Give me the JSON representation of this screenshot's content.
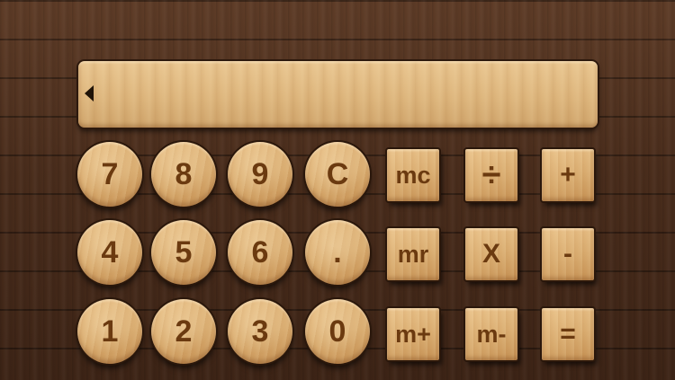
{
  "display": {
    "value": "",
    "speaker_icon": "speaker-icon"
  },
  "keys": {
    "k7": "7",
    "k8": "8",
    "k9": "9",
    "clear": "C",
    "k4": "4",
    "k5": "5",
    "k6": "6",
    "dot": ".",
    "k1": "1",
    "k2": "2",
    "k3": "3",
    "k0": "0",
    "mc": "mc",
    "mr": "mr",
    "mplus": "m+",
    "mminus": "m-",
    "divide": "÷",
    "multiply": "X",
    "equals": "=",
    "plus": "+",
    "minus": "-"
  },
  "colors": {
    "wood_light": "#e2b77b",
    "wood_dark": "#4a2d1c",
    "label": "#6b3a10"
  }
}
